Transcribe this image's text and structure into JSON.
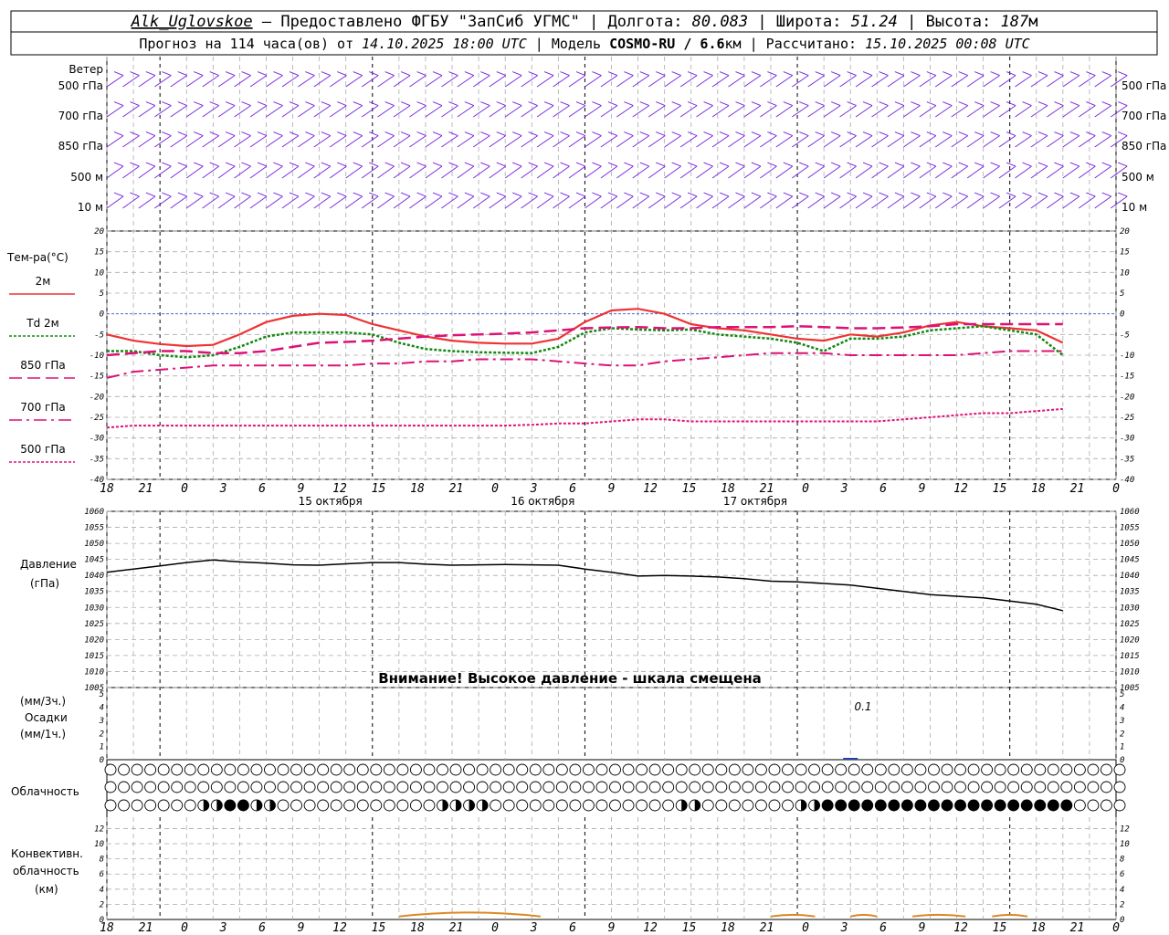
{
  "header": {
    "station": "Alk_Uglovskoe",
    "provider": " — Предоставлено ФГБУ \"ЗапСиб УГМС\" | Долгота: ",
    "lon": "80.083",
    "lat_label": " | Широта: ",
    "lat": "51.24",
    "alt_label": " | Высота: ",
    "alt": "187",
    "alt_unit": "м",
    "line2_a": "Прогноз на 114 часа(ов) от ",
    "line2_date": "14.10.2025 18:00 UTC",
    "line2_b": " | Модель ",
    "model": "COSMO-RU / 6.6",
    "model_unit": "км",
    "line2_c": " | Рассчитано: ",
    "calc": "15.10.2025 00:08 UTC"
  },
  "wind_panel": {
    "title": "Ветер",
    "levels": [
      "500 гПа",
      "700 гПа",
      "850 гПа",
      "500 м",
      "10  м"
    ]
  },
  "temp_panel": {
    "title": "Тем-ра(°С)",
    "legend": [
      {
        "name": "2м",
        "color": "#ee3333"
      },
      {
        "name": "Td  2м",
        "color": "#118811"
      },
      {
        "name": "850 гПа",
        "color": "#dd1177"
      },
      {
        "name": "700 гПа",
        "color": "#dd1177"
      },
      {
        "name": "500 гПа",
        "color": "#dd1177"
      }
    ]
  },
  "pressure_panel": {
    "title_1": "Давление",
    "title_2": "(гПа)",
    "warning": "Внимание! Высокое давление - шкала смещена"
  },
  "precip_panel": {
    "title_1": "(мм/3ч.)",
    "title_2": "Осадки",
    "title_3": "(мм/1ч.)",
    "annotation": "0.1"
  },
  "cloud_panel": {
    "title": "Облачность"
  },
  "conv_panel": {
    "title_1": "Конвективн.",
    "title_2": "облачность",
    "title_3": "(км)"
  },
  "x_axis": {
    "tick_labels": [
      "18",
      "21",
      "0",
      "3",
      "6",
      "9",
      "12",
      "15",
      "18",
      "21",
      "0",
      "3",
      "6",
      "9",
      "12",
      "15",
      "18",
      "21",
      "0",
      "3",
      "6",
      "9",
      "12",
      "15",
      "18",
      "21",
      "0"
    ],
    "dates": [
      "15 октября",
      "16 октября",
      "17 октября"
    ]
  },
  "chart_data": [
    {
      "type": "line",
      "title": "Тем-ра(°С)",
      "x_hours": [
        0,
        3,
        6,
        9,
        12,
        15,
        18,
        21,
        24,
        27,
        30,
        33,
        36,
        39,
        42,
        45,
        48,
        51,
        54,
        57,
        60,
        63,
        66,
        69,
        72,
        75,
        78,
        81,
        84,
        87,
        90,
        93,
        96,
        99,
        102,
        105,
        108
      ],
      "ylim": [
        -40,
        20
      ],
      "yticks": [
        20,
        15,
        10,
        5,
        0,
        -5,
        -10,
        -15,
        -20,
        -25,
        -30,
        -35,
        -40
      ],
      "series": [
        {
          "name": "2м",
          "color": "#ee3333",
          "values": [
            -5,
            -6.5,
            -7.3,
            -7.8,
            -7.5,
            -5,
            -2,
            -0.5,
            0,
            -0.3,
            -2.5,
            -4,
            -5.5,
            -6.5,
            -7,
            -7.2,
            -7.2,
            -6,
            -2,
            0.8,
            1.2,
            0,
            -2.5,
            -3.5,
            -4,
            -5,
            -6,
            -6.5,
            -5,
            -5.5,
            -4.5,
            -2.8,
            -2,
            -3,
            -3.5,
            -4,
            -7
          ]
        },
        {
          "name": "Td  2м",
          "color": "#118811",
          "values": [
            -9,
            -9,
            -10,
            -10.5,
            -10,
            -8,
            -5.5,
            -4.5,
            -4.5,
            -4.5,
            -5,
            -7,
            -8.5,
            -9,
            -9.3,
            -9.4,
            -9.5,
            -8,
            -4.5,
            -3.5,
            -3.8,
            -4,
            -3.8,
            -5,
            -5.5,
            -6,
            -7,
            -9,
            -6,
            -6,
            -5.5,
            -4,
            -3.5,
            -3,
            -4,
            -5,
            -10
          ]
        },
        {
          "name": "850 гПа",
          "color": "#dd1177",
          "values": [
            -10,
            -9.5,
            -9,
            -9,
            -9.5,
            -9.5,
            -9,
            -8,
            -7,
            -6.8,
            -6.5,
            -6,
            -5.5,
            -5.2,
            -5,
            -4.8,
            -4.5,
            -4,
            -3.5,
            -3.3,
            -3.2,
            -3.5,
            -3.5,
            -3.2,
            -3.2,
            -3.2,
            -3,
            -3.2,
            -3.5,
            -3.5,
            -3.3,
            -3,
            -2.5,
            -2.5,
            -2.5,
            -2.5,
            -2.5
          ]
        },
        {
          "name": "700 гПа",
          "color": "#dd1177",
          "values": [
            -15.5,
            -14,
            -13.5,
            -13,
            -12.5,
            -12.5,
            -12.5,
            -12.5,
            -12.5,
            -12.5,
            -12,
            -12,
            -11.5,
            -11.5,
            -11,
            -11,
            -11,
            -11.5,
            -12,
            -12.5,
            -12.5,
            -11.5,
            -11,
            -10.5,
            -10,
            -9.5,
            -9.5,
            -9.5,
            -10,
            -10,
            -10,
            -10,
            -10,
            -9.5,
            -9,
            -9,
            -9
          ]
        },
        {
          "name": "500 гПа",
          "color": "#dd1177",
          "values": [
            -27.5,
            -27,
            -27,
            -27,
            -27,
            -27,
            -27,
            -27,
            -27,
            -27,
            -27,
            -27,
            -27,
            -27,
            -27,
            -27,
            -26.8,
            -26.5,
            -26.5,
            -26,
            -25.5,
            -25.5,
            -26,
            -26,
            -26,
            -26,
            -26,
            -26,
            -26,
            -26,
            -25.5,
            -25,
            -24.5,
            -24,
            -24,
            -23.5,
            -23
          ]
        }
      ]
    },
    {
      "type": "line",
      "title": "Давление",
      "ylabel": "(гПа)",
      "x_hours": [
        0,
        3,
        6,
        9,
        12,
        15,
        18,
        21,
        24,
        27,
        30,
        33,
        36,
        39,
        42,
        45,
        48,
        51,
        54,
        57,
        60,
        63,
        66,
        69,
        72,
        75,
        78,
        81,
        84,
        87,
        90,
        93,
        96,
        99,
        102,
        105,
        108
      ],
      "ylim": [
        1005,
        1060
      ],
      "yticks": [
        1060,
        1055,
        1050,
        1045,
        1040,
        1035,
        1030,
        1025,
        1020,
        1015,
        1010,
        1005
      ],
      "series": [
        {
          "name": "Давление",
          "color": "#000000",
          "values": [
            1041,
            1042,
            1043,
            1044,
            1044.8,
            1044.2,
            1043.8,
            1043.3,
            1043.2,
            1043.6,
            1044,
            1044,
            1043.5,
            1043.2,
            1043.3,
            1043.4,
            1043.3,
            1043.2,
            1042,
            1041,
            1039.8,
            1040,
            1039.8,
            1039.5,
            1039,
            1038.2,
            1038,
            1037.5,
            1037,
            1036,
            1035,
            1034,
            1033.5,
            1033,
            1032,
            1031,
            1029
          ]
        }
      ]
    },
    {
      "type": "bar",
      "title": "Осадки",
      "ylim": [
        0,
        5
      ],
      "yticks": [
        5,
        4,
        3,
        2,
        1,
        0
      ],
      "x_hours": [
        84
      ],
      "values": [
        0.1
      ]
    },
    {
      "type": "heatmap",
      "title": "Облачность",
      "x_hours": [
        0,
        3,
        6,
        9,
        12,
        15,
        18,
        21,
        24,
        27,
        30,
        33,
        36,
        39,
        42,
        45,
        48,
        51,
        54,
        57,
        60,
        63,
        66,
        69,
        72,
        75,
        78,
        81,
        84,
        87,
        90,
        93,
        96,
        99,
        102,
        105,
        108
      ],
      "rows": [
        {
          "level": "upper",
          "values": [
            0,
            0,
            0,
            0,
            0,
            0,
            0,
            0,
            0,
            0,
            0,
            0,
            0,
            0,
            0,
            0,
            0,
            0,
            0,
            0,
            0,
            0,
            0,
            0,
            0,
            0,
            0,
            0,
            0,
            0,
            0,
            0,
            0,
            0,
            0,
            0,
            0
          ]
        },
        {
          "level": "middle",
          "values": [
            0,
            0,
            0,
            0,
            0,
            0,
            0,
            0,
            0,
            0,
            0,
            0,
            0,
            0,
            0,
            0,
            0,
            0,
            0,
            0,
            0,
            0,
            0,
            0,
            0,
            0,
            0,
            0,
            0,
            0,
            0,
            0,
            0,
            0,
            0,
            0,
            0
          ]
        },
        {
          "level": "lower",
          "values": [
            0,
            0,
            0,
            0,
            0.5,
            1,
            0.5,
            0,
            0,
            0,
            0,
            0,
            0,
            0.5,
            0.75,
            0,
            0,
            0,
            0,
            0,
            0,
            0,
            0.5,
            0,
            0,
            0,
            0,
            0,
            0,
            0.5,
            1,
            1,
            1,
            1,
            1,
            1,
            1,
            0,
            0,
            0,
            0
          ]
        }
      ]
    },
    {
      "type": "area",
      "title": "Конвективн. облачность",
      "ylabel": "(км)",
      "ylim": [
        0,
        13
      ],
      "yticks": [
        12,
        10,
        8,
        6,
        4,
        2,
        0
      ],
      "segments": [
        {
          "from_hour": 33,
          "to_hour": 49,
          "peak_km": 1.2
        },
        {
          "from_hour": 75,
          "to_hour": 80,
          "peak_km": 0.6
        },
        {
          "from_hour": 84,
          "to_hour": 87,
          "peak_km": 0.6
        },
        {
          "from_hour": 91,
          "to_hour": 97,
          "peak_km": 0.6
        },
        {
          "from_hour": 100,
          "to_hour": 104,
          "peak_km": 0.6
        }
      ]
    }
  ]
}
